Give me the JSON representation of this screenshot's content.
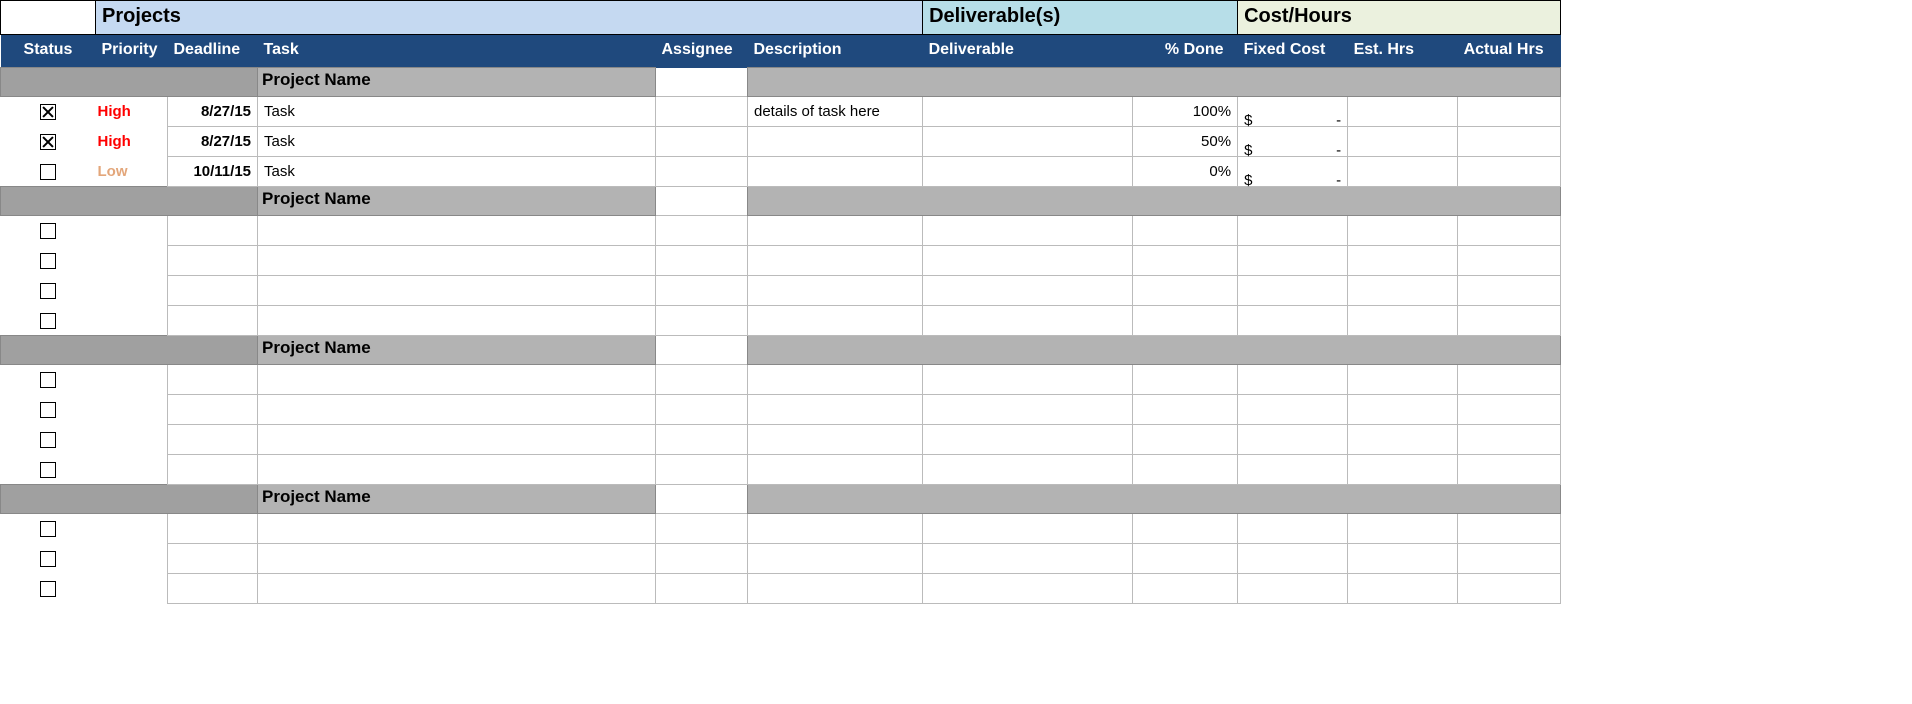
{
  "bands": {
    "projects": "Projects",
    "deliverables": "Deliverable(s)",
    "cost": "Cost/Hours"
  },
  "headers": {
    "status": "Status",
    "priority": "Priority",
    "deadline": "Deadline",
    "task": "Task",
    "assignee": "Assignee",
    "description": "Description",
    "deliverable": "Deliverable",
    "pct_done": "% Done",
    "fixed_cost": "Fixed Cost",
    "est_hrs": "Est. Hrs",
    "actual_hrs": "Actual Hrs"
  },
  "priority_colors": {
    "High": "prio-high",
    "Low": "prio-low"
  },
  "sections": [
    {
      "title": "Project Name",
      "rows": [
        {
          "checked": true,
          "priority": "High",
          "deadline": "8/27/15",
          "task": "Task",
          "assignee": "",
          "description": "details of task here",
          "deliverable": "",
          "pct_done": "100%",
          "fixed_cost_sym": "$",
          "fixed_cost_val": "-",
          "est_hrs": "",
          "actual_hrs": ""
        },
        {
          "checked": true,
          "priority": "High",
          "deadline": "8/27/15",
          "task": "Task",
          "assignee": "",
          "description": "",
          "deliverable": "",
          "pct_done": "50%",
          "fixed_cost_sym": "$",
          "fixed_cost_val": "-",
          "est_hrs": "",
          "actual_hrs": ""
        },
        {
          "checked": false,
          "priority": "Low",
          "deadline": "10/11/15",
          "task": "Task",
          "assignee": "",
          "description": "",
          "deliverable": "",
          "pct_done": "0%",
          "fixed_cost_sym": "$",
          "fixed_cost_val": "-",
          "est_hrs": "",
          "actual_hrs": ""
        }
      ]
    },
    {
      "title": "Project Name",
      "rows": [
        {
          "checked": false,
          "priority": "",
          "deadline": "",
          "task": "",
          "assignee": "",
          "description": "",
          "deliverable": "",
          "pct_done": "",
          "fixed_cost_sym": "",
          "fixed_cost_val": "",
          "est_hrs": "",
          "actual_hrs": ""
        },
        {
          "checked": false,
          "priority": "",
          "deadline": "",
          "task": "",
          "assignee": "",
          "description": "",
          "deliverable": "",
          "pct_done": "",
          "fixed_cost_sym": "",
          "fixed_cost_val": "",
          "est_hrs": "",
          "actual_hrs": ""
        },
        {
          "checked": false,
          "priority": "",
          "deadline": "",
          "task": "",
          "assignee": "",
          "description": "",
          "deliverable": "",
          "pct_done": "",
          "fixed_cost_sym": "",
          "fixed_cost_val": "",
          "est_hrs": "",
          "actual_hrs": ""
        },
        {
          "checked": false,
          "priority": "",
          "deadline": "",
          "task": "",
          "assignee": "",
          "description": "",
          "deliverable": "",
          "pct_done": "",
          "fixed_cost_sym": "",
          "fixed_cost_val": "",
          "est_hrs": "",
          "actual_hrs": ""
        }
      ]
    },
    {
      "title": "Project Name",
      "rows": [
        {
          "checked": false,
          "priority": "",
          "deadline": "",
          "task": "",
          "assignee": "",
          "description": "",
          "deliverable": "",
          "pct_done": "",
          "fixed_cost_sym": "",
          "fixed_cost_val": "",
          "est_hrs": "",
          "actual_hrs": ""
        },
        {
          "checked": false,
          "priority": "",
          "deadline": "",
          "task": "",
          "assignee": "",
          "description": "",
          "deliverable": "",
          "pct_done": "",
          "fixed_cost_sym": "",
          "fixed_cost_val": "",
          "est_hrs": "",
          "actual_hrs": ""
        },
        {
          "checked": false,
          "priority": "",
          "deadline": "",
          "task": "",
          "assignee": "",
          "description": "",
          "deliverable": "",
          "pct_done": "",
          "fixed_cost_sym": "",
          "fixed_cost_val": "",
          "est_hrs": "",
          "actual_hrs": ""
        },
        {
          "checked": false,
          "priority": "",
          "deadline": "",
          "task": "",
          "assignee": "",
          "description": "",
          "deliverable": "",
          "pct_done": "",
          "fixed_cost_sym": "",
          "fixed_cost_val": "",
          "est_hrs": "",
          "actual_hrs": ""
        }
      ]
    },
    {
      "title": "Project Name",
      "rows": [
        {
          "checked": false,
          "priority": "",
          "deadline": "",
          "task": "",
          "assignee": "",
          "description": "",
          "deliverable": "",
          "pct_done": "",
          "fixed_cost_sym": "",
          "fixed_cost_val": "",
          "est_hrs": "",
          "actual_hrs": ""
        },
        {
          "checked": false,
          "priority": "",
          "deadline": "",
          "task": "",
          "assignee": "",
          "description": "",
          "deliverable": "",
          "pct_done": "",
          "fixed_cost_sym": "",
          "fixed_cost_val": "",
          "est_hrs": "",
          "actual_hrs": ""
        },
        {
          "checked": false,
          "priority": "",
          "deadline": "",
          "task": "",
          "assignee": "",
          "description": "",
          "deliverable": "",
          "pct_done": "",
          "fixed_cost_sym": "",
          "fixed_cost_val": "",
          "est_hrs": "",
          "actual_hrs": ""
        }
      ]
    }
  ]
}
